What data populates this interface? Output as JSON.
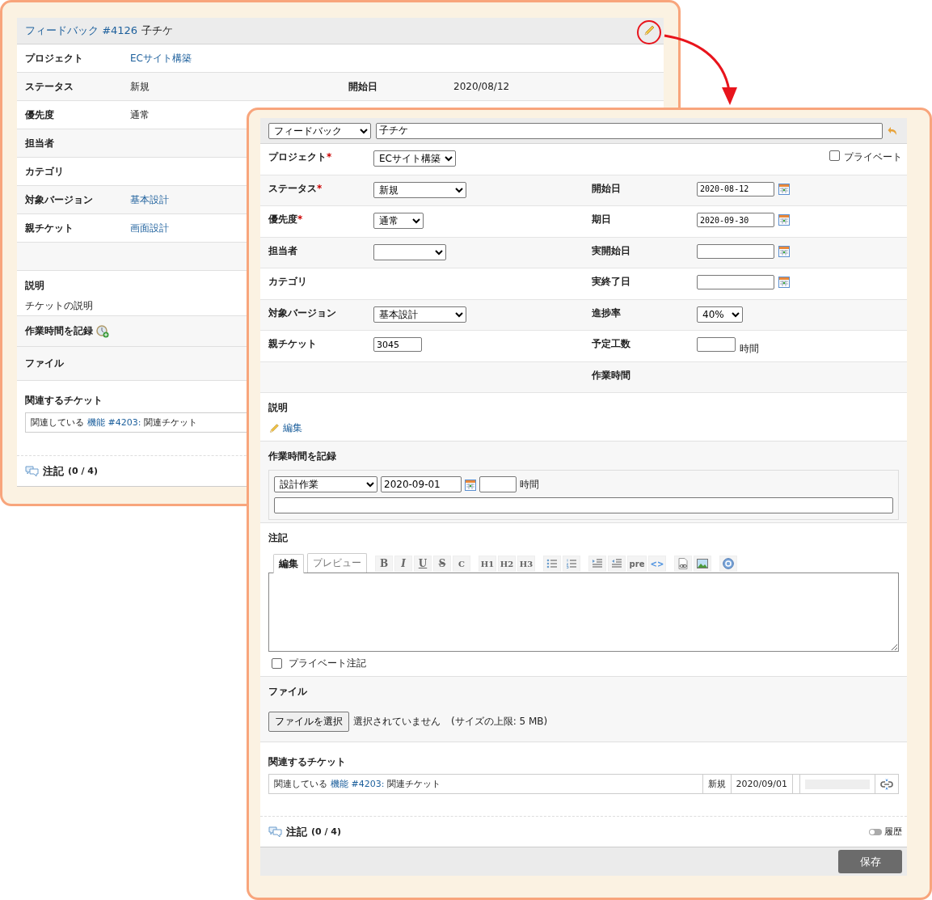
{
  "required_mark": "*",
  "back_panel": {
    "header": {
      "tracker": "フィードバック",
      "number": "#4126",
      "subject": "子チケ"
    },
    "rows": [
      {
        "label": "プロジェクト",
        "value": "ECサイト構築",
        "link": true
      },
      {
        "label": "ステータス",
        "value": "新規",
        "link": false,
        "right_label": "開始日",
        "right_value": "2020/08/12"
      },
      {
        "label": "優先度",
        "value": "通常",
        "link": false
      },
      {
        "label": "担当者"
      },
      {
        "label": "カテゴリ"
      },
      {
        "label": "対象バージョン",
        "value": "基本設計",
        "link": true
      },
      {
        "label": "親チケット",
        "value": "画面設計",
        "link": true
      }
    ],
    "description": {
      "label": "説明",
      "text": "チケットの説明"
    },
    "time_entry": {
      "label": "作業時間を記録"
    },
    "files": {
      "label": "ファイル"
    },
    "related": {
      "label": "関連するチケット",
      "relation": "関連している",
      "tracker": "機能",
      "number": "#4203:",
      "subject": "関連チケット"
    },
    "notes": {
      "label": "注記",
      "count": "(0 / 4)"
    }
  },
  "front_panel": {
    "header": {
      "tracker": "フィードバック",
      "subject": "子チケ"
    },
    "fields": [
      {
        "label": "プロジェクト",
        "required": true,
        "control": {
          "kind": "select",
          "value": "ECサイト構築"
        },
        "right": {
          "kind": "checkbox",
          "label": "プライベート",
          "checked": false
        }
      },
      {
        "label": "ステータス",
        "required": true,
        "control": {
          "kind": "select",
          "value": "新規"
        },
        "right": {
          "kind": "date",
          "label": "開始日",
          "value": "2020-08-12"
        }
      },
      {
        "label": "優先度",
        "required": true,
        "control": {
          "kind": "select",
          "value": "通常"
        },
        "right": {
          "kind": "date",
          "label": "期日",
          "value": "2020-09-30"
        }
      },
      {
        "label": "担当者",
        "required": false,
        "control": {
          "kind": "select"
        },
        "right": {
          "kind": "date",
          "label": "実開始日"
        }
      },
      {
        "label": "カテゴリ",
        "required": false,
        "right": {
          "kind": "date",
          "label": "実終了日"
        }
      },
      {
        "label": "対象バージョン",
        "required": false,
        "control": {
          "kind": "select",
          "value": "基本設計"
        },
        "right": {
          "kind": "select",
          "label": "進捗率",
          "value": "40%"
        }
      },
      {
        "label": "親チケット",
        "required": false,
        "control": {
          "kind": "text",
          "value": "3045"
        },
        "right": {
          "kind": "hours",
          "label": "予定工数",
          "unit": "時間"
        }
      },
      {
        "right": {
          "kind": "label",
          "label": "作業時間"
        }
      }
    ],
    "description": {
      "label": "説明",
      "edit_link": "編集"
    },
    "time_entry": {
      "label": "作業時間を記録",
      "activity": "設計作業",
      "date": "2020-09-01",
      "unit": "時間"
    },
    "notes_editor": {
      "label": "注記",
      "tabs": [
        {
          "label": "編集",
          "selected": true
        },
        {
          "label": "プレビュー",
          "selected": false
        }
      ],
      "toolbar": [
        [
          {
            "kind": "bold",
            "label": "B"
          },
          {
            "kind": "italic",
            "label": "I"
          },
          {
            "kind": "underline",
            "label": "U"
          },
          {
            "kind": "strike",
            "label": "S"
          },
          {
            "kind": "serif",
            "label": "C"
          }
        ],
        [
          {
            "kind": "serif",
            "label": "H1"
          },
          {
            "kind": "serif",
            "label": "H2"
          },
          {
            "kind": "serif",
            "label": "H3"
          }
        ],
        [
          {
            "kind": "bullets"
          },
          {
            "kind": "numbers"
          }
        ],
        [
          {
            "kind": "indent"
          },
          {
            "kind": "outdent"
          },
          {
            "kind": "mono",
            "label": "pre"
          },
          {
            "kind": "blue",
            "label": "<>"
          }
        ],
        [
          {
            "kind": "attachment"
          },
          {
            "kind": "image"
          }
        ],
        [
          {
            "kind": "help"
          }
        ]
      ],
      "private_notes": {
        "label": "プライベート注記",
        "checked": false
      }
    },
    "files": {
      "label": "ファイル",
      "button": "ファイルを選択",
      "status": "選択されていません",
      "limit": "(サイズの上限: 5 MB)"
    },
    "related": {
      "label": "関連するチケット",
      "relation": "関連している",
      "tracker": "機能",
      "number": "#4203:",
      "subject": "関連チケット",
      "status": "新規",
      "date": "2020/09/01",
      "level": 0
    },
    "notes": {
      "label": "注記",
      "count": "(0 / 4)",
      "history": {
        "label": "履歴",
        "on": false
      }
    },
    "save_button": "保存"
  }
}
